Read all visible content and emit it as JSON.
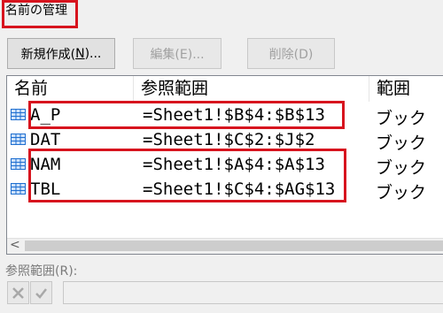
{
  "dialog": {
    "title": "名前の管理"
  },
  "toolbar": {
    "new_label": "新規作成(",
    "new_key": "N",
    "new_suffix": ")...",
    "edit_label": "編集(E)...",
    "delete_label": "削除(D)"
  },
  "list": {
    "columns": [
      "名前",
      "参照範囲",
      "範囲"
    ],
    "rows": [
      {
        "name": "A_P",
        "ref": "=Sheet1!$B$4:$B$13",
        "scope": "ブック"
      },
      {
        "name": "DAT",
        "ref": "=Sheet1!$C$2:$J$2",
        "scope": "ブック"
      },
      {
        "name": "NAM",
        "ref": "=Sheet1!$A$4:$A$13",
        "scope": "ブック"
      },
      {
        "name": "TBL",
        "ref": "=Sheet1!$C$4:$AG$13",
        "scope": "ブック"
      }
    ],
    "scroll_left_glyph": "<"
  },
  "refers_to": {
    "label": "参照範囲(R):",
    "value": ""
  },
  "icons": {
    "row": "table-name-icon",
    "cancel": "x-icon",
    "confirm": "check-icon"
  },
  "colors": {
    "highlight": "#d7141e",
    "icon_blue": "#1f6fd0"
  }
}
